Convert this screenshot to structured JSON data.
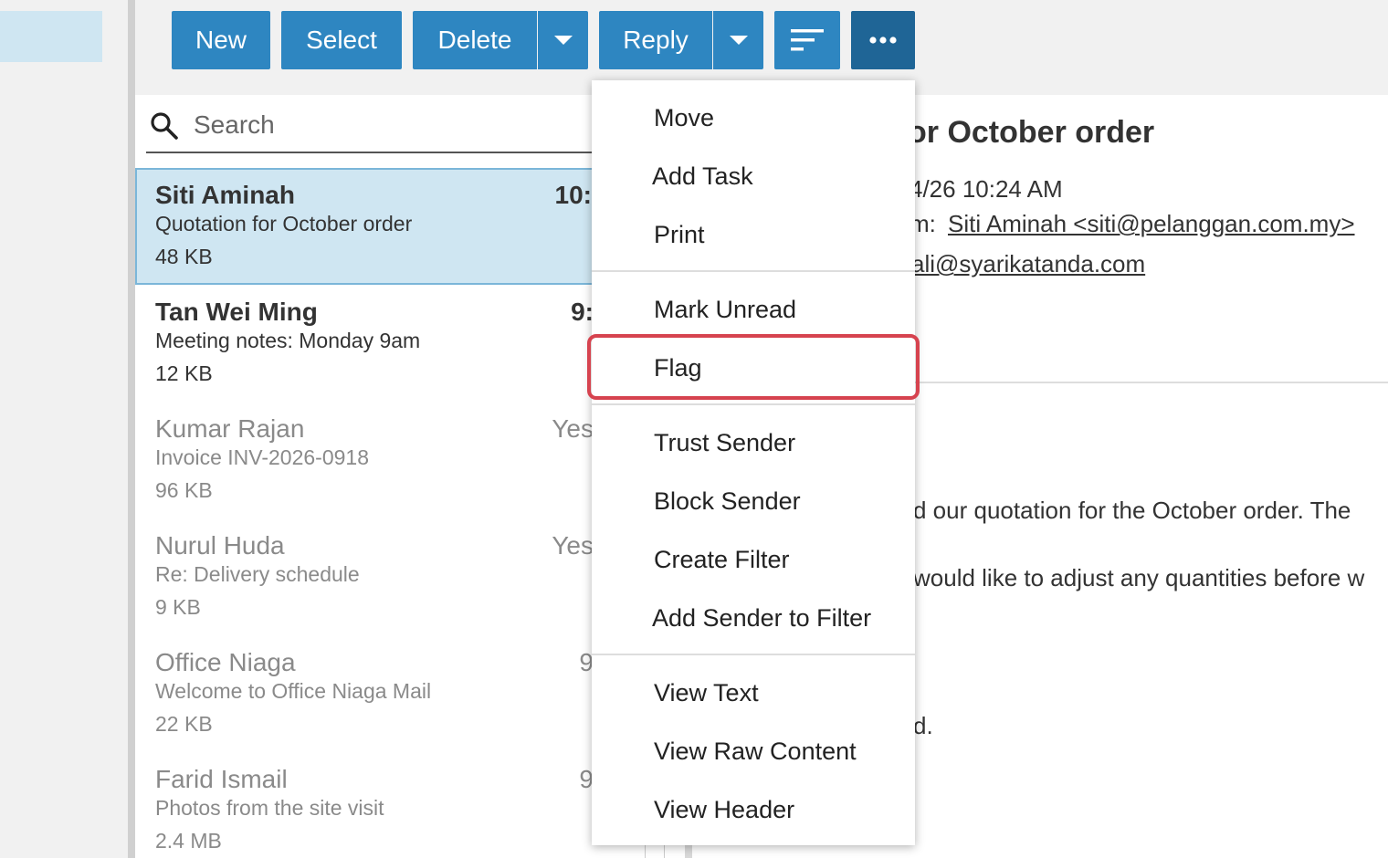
{
  "toolbar": {
    "new_label": "New",
    "select_label": "Select",
    "delete_label": "Delete",
    "reply_label": "Reply",
    "accent_color": "#2e86c1",
    "active_color": "#1f6596"
  },
  "search": {
    "placeholder": "Search"
  },
  "messages": [
    {
      "sender": "Siti Aminah",
      "time": "10:",
      "subject": "Quotation for October order",
      "size": "48 KB",
      "state": "selected-unread"
    },
    {
      "sender": "Tan Wei Ming",
      "time": "9:",
      "subject": "Meeting notes: Monday 9am",
      "size": "12 KB",
      "state": "unread"
    },
    {
      "sender": "Kumar Rajan",
      "time": "Yes",
      "subject": "Invoice INV-2026-0918",
      "size": "96 KB",
      "state": "read"
    },
    {
      "sender": "Nurul Huda",
      "time": "Yes",
      "subject": "Re: Delivery schedule",
      "size": "9 KB",
      "state": "read"
    },
    {
      "sender": "Office Niaga",
      "time": "9",
      "subject": "Welcome to Office Niaga Mail",
      "size": "22 KB",
      "state": "read"
    },
    {
      "sender": "Farid Ismail",
      "time": "9",
      "subject": "Photos from the site visit",
      "size": "2.4 MB",
      "state": "read"
    }
  ],
  "reading_pane": {
    "title_fragment": "or October order",
    "date_fragment": "4/26 10:24 AM",
    "from_label_fragment": "m:",
    "from": "Siti Aminah <siti@pelanggan.com.my>",
    "to_fragment": "ali@syarikatanda.com",
    "body_fragments": [
      "d our quotation for the October order. The",
      "would like to adjust any quantities before w",
      "d."
    ]
  },
  "menu": {
    "items": [
      "Move",
      "Add Task",
      "Print",
      "Mark Unread",
      "Flag",
      "Trust Sender",
      "Block Sender",
      "Create Filter",
      "Add Sender to Filter",
      "View Text",
      "View Raw Content",
      "View Header"
    ],
    "highlighted": "Flag",
    "highlight_color": "#d6434f"
  }
}
